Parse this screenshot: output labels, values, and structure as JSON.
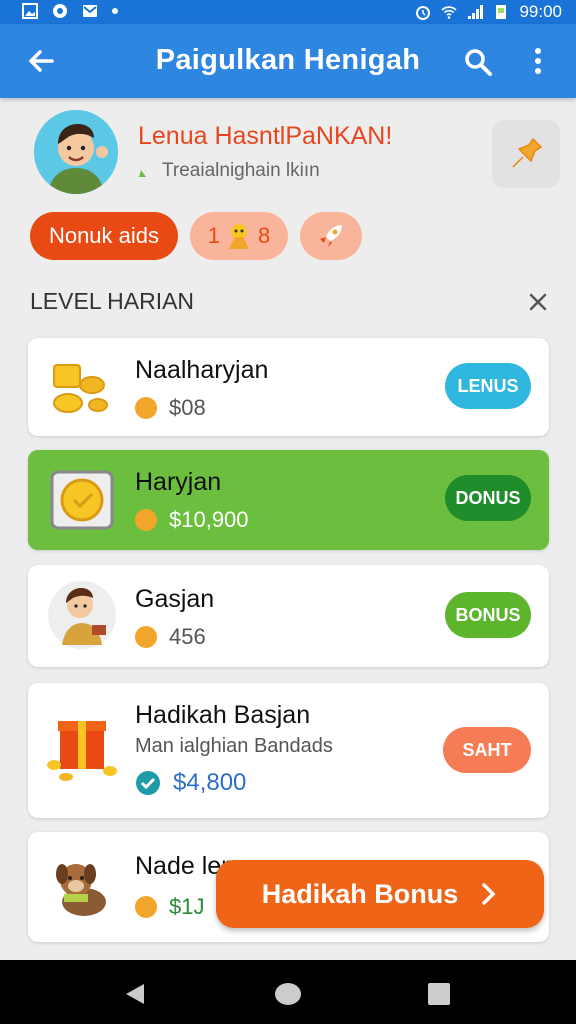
{
  "status_bar": {
    "time": "99:00",
    "left_icons": [
      "gallery-icon",
      "circle-app-icon",
      "mail-icon",
      "dot-icon"
    ],
    "right_icons": [
      "alarm-icon",
      "wifi-icon",
      "signal-icon",
      "battery-icon"
    ]
  },
  "app_bar": {
    "title": "Paigulkan Henigah",
    "back_icon": "back-arrow-icon",
    "search_icon": "search-icon",
    "more_icon": "more-vert-icon",
    "color": "#2f86e0"
  },
  "profile": {
    "name": "Lenua HasntlPaNKAN!",
    "subtitle": "Treaialnighain lkiın",
    "pin_icon": "pin-icon"
  },
  "chips": {
    "primary_label": "Nonuk aids",
    "level_label_left": "1",
    "level_label_right": "8",
    "boost_icon": "rocket-icon"
  },
  "section": {
    "title": "LEVEL HARIAN",
    "close_icon": "close-icon"
  },
  "levels": [
    {
      "name": "Naalharyjan",
      "amount": "$08",
      "badge": "LENUS",
      "badge_color": "#2fb7e0",
      "icon": "gold-coins-icon"
    },
    {
      "name": "Haryjan",
      "amount": "$10,900",
      "badge": "DONUS",
      "badge_color": "#1f8d2c",
      "icon": "gold-medal-icon",
      "highlight_color": "#6cbf3e"
    },
    {
      "name": "Gasjan",
      "amount": "456",
      "badge": "BONUS",
      "badge_color": "#5cb52b",
      "icon": "kid-character-icon"
    },
    {
      "name": "Hadikah Basjan",
      "subtitle": "Man ialghian Bandads",
      "amount": "$4,800",
      "badge": "SAHT",
      "badge_color": "#f57c55",
      "icon": "gift-box-icon"
    },
    {
      "name": "Nade lenn",
      "amount": "$1J",
      "icon": "puppy-icon"
    }
  ],
  "cta": {
    "label": "Hadikah Bonus",
    "icon": "chevron-right-icon",
    "color": "#f06418"
  },
  "nav_bar": {
    "icons": [
      "nav-back-icon",
      "nav-home-icon",
      "nav-recents-icon"
    ]
  }
}
